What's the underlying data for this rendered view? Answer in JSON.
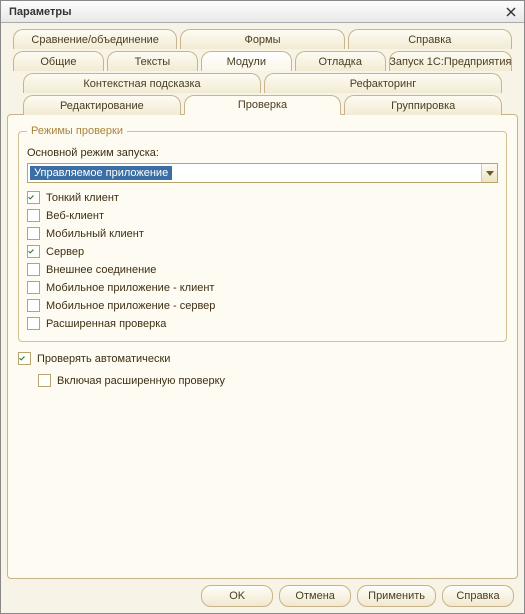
{
  "window": {
    "title": "Параметры"
  },
  "tabs": {
    "row1": [
      {
        "label": "Сравнение/объединение"
      },
      {
        "label": "Формы"
      },
      {
        "label": "Справка"
      }
    ],
    "row2": [
      {
        "label": "Общие"
      },
      {
        "label": "Тексты"
      },
      {
        "label": "Модули",
        "active": true
      },
      {
        "label": "Отладка"
      },
      {
        "label": "Запуск 1С:Предприятия"
      }
    ],
    "row3": [
      {
        "label": "Контекстная подсказка"
      },
      {
        "label": "Рефакторинг"
      }
    ],
    "row4": [
      {
        "label": "Редактирование"
      },
      {
        "label": "Проверка",
        "active": true
      },
      {
        "label": "Группировка"
      }
    ]
  },
  "group": {
    "legend": "Режимы проверки",
    "mode_label": "Основной режим запуска:",
    "mode_value": "Управляемое приложение",
    "checks": [
      {
        "label": "Тонкий клиент",
        "checked": true
      },
      {
        "label": "Веб-клиент",
        "checked": false
      },
      {
        "label": "Мобильный клиент",
        "checked": false
      },
      {
        "label": "Сервер",
        "checked": true
      },
      {
        "label": "Внешнее соединение",
        "checked": false
      },
      {
        "label": "Мобильное приложение - клиент",
        "checked": false
      },
      {
        "label": "Мобильное приложение - сервер",
        "checked": false
      },
      {
        "label": "Расширенная проверка",
        "checked": false
      }
    ]
  },
  "auto_check": {
    "label": "Проверять автоматически",
    "checked": true
  },
  "include_ext": {
    "label": "Включая расширенную проверку",
    "checked": false
  },
  "buttons": {
    "ok": "OK",
    "cancel": "Отмена",
    "apply": "Применить",
    "help": "Справка"
  }
}
